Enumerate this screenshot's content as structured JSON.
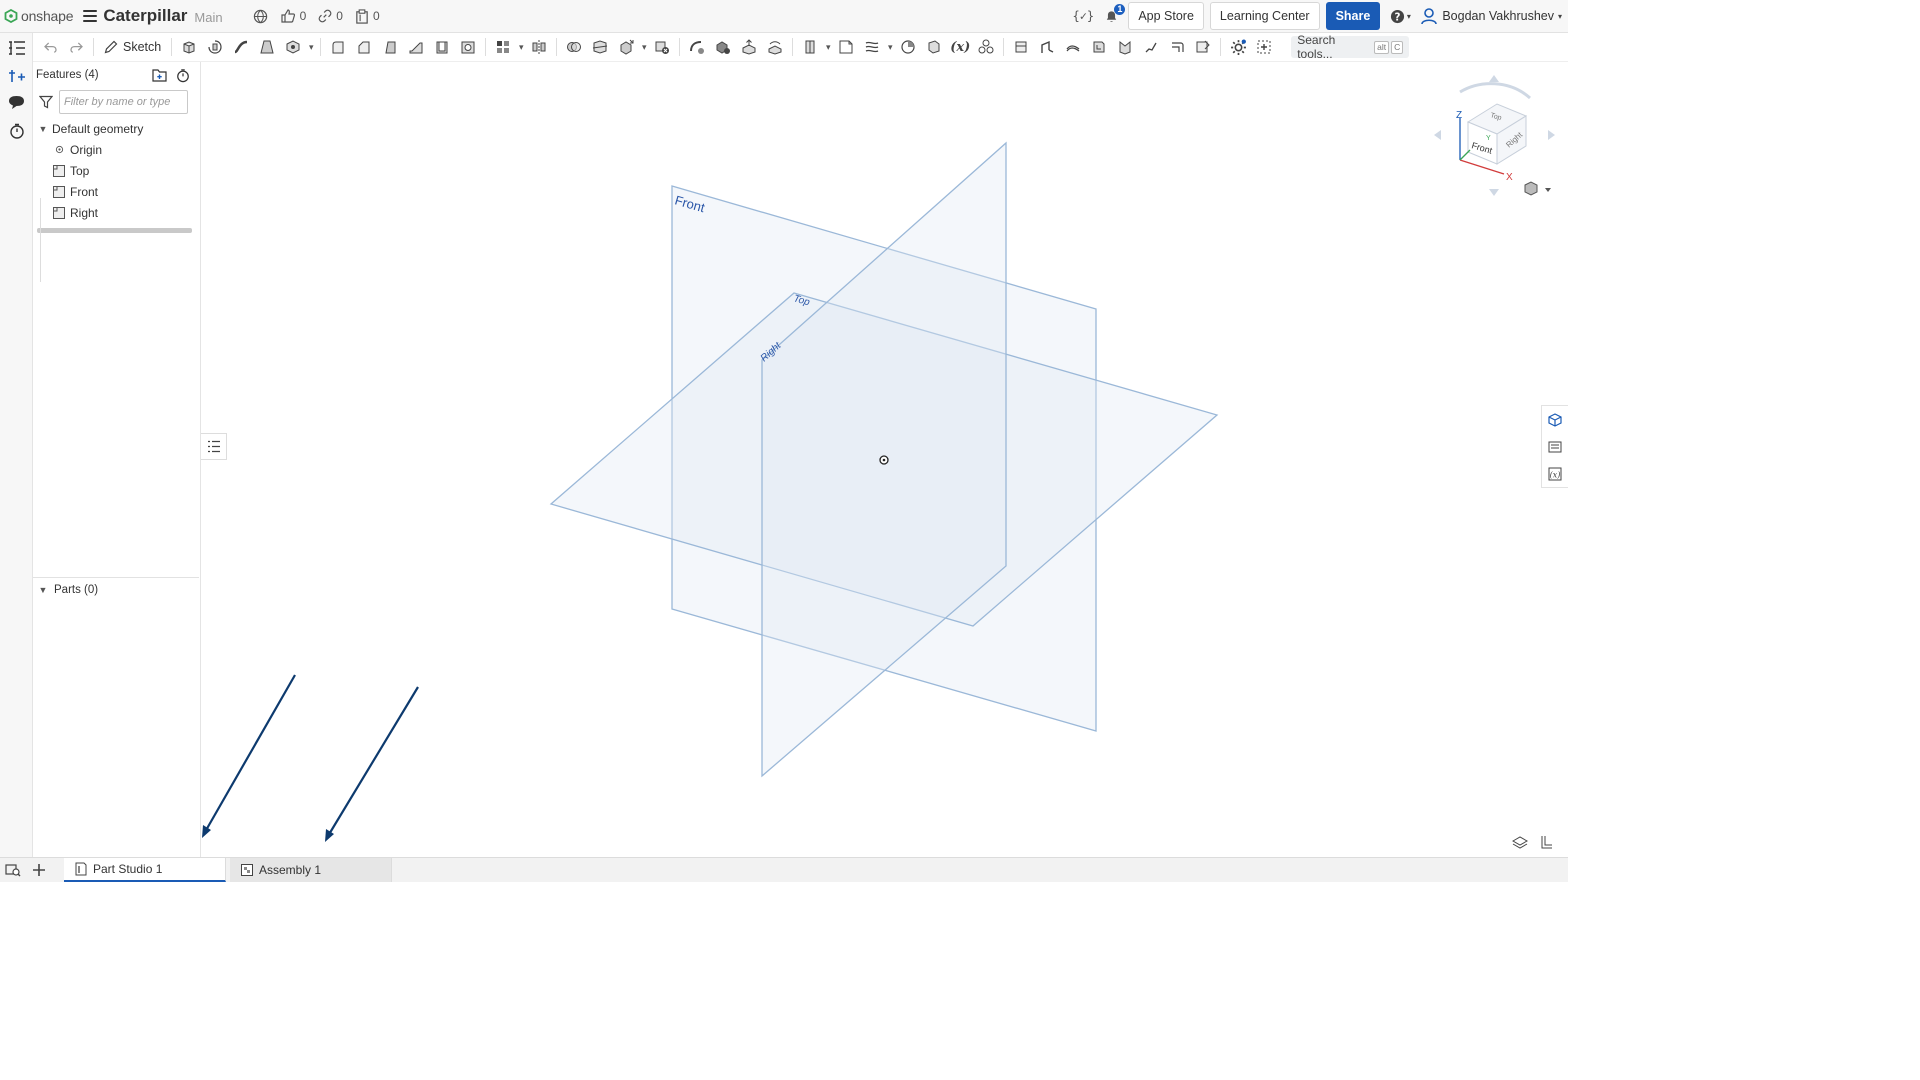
{
  "app": {
    "logo_text": "onshape",
    "doc_title": "Caterpillar",
    "branch": "Main"
  },
  "top_counters": {
    "likes": "0",
    "links": "0",
    "copies": "0"
  },
  "top_right": {
    "notifications_count": "1",
    "app_store": "App Store",
    "learning_center": "Learning Center",
    "share": "Share",
    "user_name": "Bogdan Vakhrushev"
  },
  "toolbar": {
    "sketch_label": "Sketch",
    "search_label": "Search tools...",
    "search_kbd_1": "alt",
    "search_kbd_2": "C"
  },
  "panel": {
    "features_title": "Features (4)",
    "filter_placeholder": "Filter by name or type",
    "default_geometry": "Default geometry",
    "items": [
      {
        "label": "Origin"
      },
      {
        "label": "Top"
      },
      {
        "label": "Front"
      },
      {
        "label": "Right"
      }
    ],
    "parts_title": "Parts (0)"
  },
  "viewport": {
    "planes": {
      "front": "Front",
      "top": "Top",
      "right": "Right"
    },
    "view_cube": {
      "front": "Front",
      "top": "Top",
      "right": "Right",
      "axis_x": "X",
      "axis_y": "Y",
      "axis_z": "Z"
    }
  },
  "tabs": [
    {
      "label": "Part Studio 1"
    },
    {
      "label": "Assembly 1"
    }
  ],
  "colors": {
    "accent": "#1a5bb5",
    "plane_stroke": "#9bb8d8",
    "plane_fill": "#dfe8f3",
    "annotation_arrow": "#0d3a6e"
  }
}
